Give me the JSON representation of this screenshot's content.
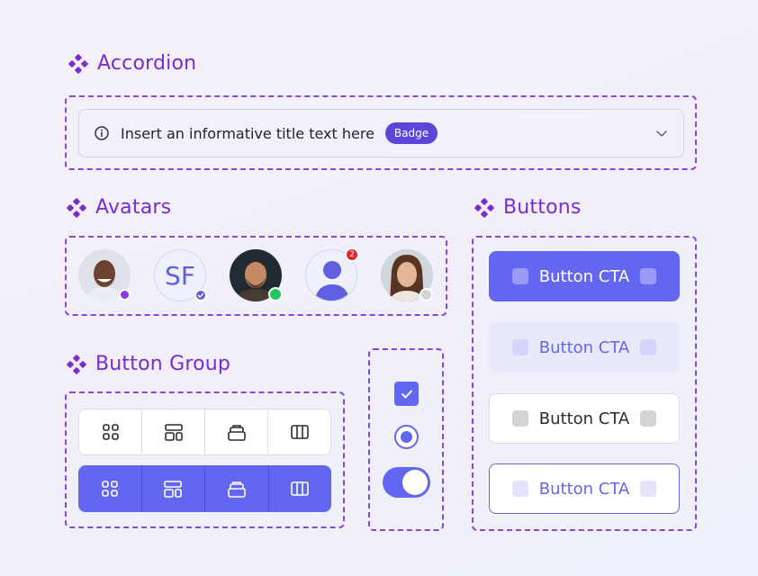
{
  "sections": {
    "accordion": "Accordion",
    "avatars": "Avatars",
    "buttons": "Buttons",
    "button_group": "Button Group"
  },
  "accordion": {
    "title": "Insert an informative title text here",
    "badge": "Badge",
    "expanded": false
  },
  "avatars": [
    {
      "kind": "photo",
      "status": "verified-purple"
    },
    {
      "kind": "initials",
      "text": "SF",
      "status": "verified-blue"
    },
    {
      "kind": "photo",
      "status": "online"
    },
    {
      "kind": "user-icon",
      "notifications": "2"
    },
    {
      "kind": "photo",
      "status": "offline"
    }
  ],
  "buttons": {
    "primary": "Button CTA",
    "soft": "Button CTA",
    "white": "Button CTA",
    "outline": "Button CTA"
  },
  "button_group": {
    "icons": [
      "grid-icon",
      "layout-icon",
      "stack-icon",
      "columns-icon"
    ]
  },
  "controls": {
    "checkbox_checked": true,
    "radio_selected": true,
    "toggle_on": true
  },
  "colors": {
    "accent": "#6366f1",
    "heading": "#7a2bd6",
    "badge": "#5b46d9",
    "online": "#22c55e",
    "notification": "#e5252a"
  }
}
